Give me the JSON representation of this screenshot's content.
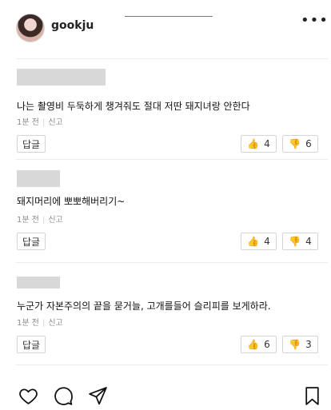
{
  "header": {
    "username": "gookju",
    "more_label": "•••"
  },
  "comments": [
    {
      "author_redacted": true,
      "text": "나는 촬영비 두둑하게 챙겨줘도 절대 저딴 돼지녀랑 안한다",
      "time": "1분 전",
      "report": "신고",
      "reply_label": "답글",
      "likes": "4",
      "dislikes": "6"
    },
    {
      "author_redacted": true,
      "text": "돼지머리에 뽀뽀해버리기~",
      "time": "1분 전",
      "report": "신고",
      "reply_label": "답글",
      "likes": "4",
      "dislikes": "4"
    },
    {
      "author_redacted": true,
      "text": "누군가 자본주의의 끝을 묻거늘, 고개를들어 슬리피를 보게하라.",
      "time": "1분 전",
      "report": "신고",
      "reply_label": "답글",
      "likes": "6",
      "dislikes": "3"
    }
  ],
  "icons": {
    "like": "heart-icon",
    "comment": "comment-icon",
    "share": "send-icon",
    "save": "bookmark-icon",
    "thumbs_up": "thumbs-up-icon",
    "thumbs_down": "thumbs-down-icon",
    "more": "more-icon"
  },
  "colors": {
    "text": "#222222",
    "muted": "#8b8b8b",
    "border": "#d5d5d5",
    "thumb": "#e99076"
  }
}
